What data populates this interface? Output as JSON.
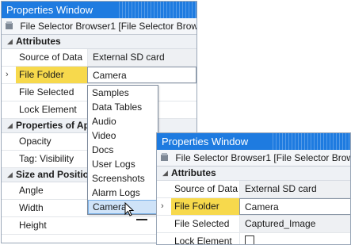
{
  "colors": {
    "titlebar": "#1e7be0",
    "selected_row": "#f7d94c",
    "highlight": "#cfe3f8"
  },
  "window1": {
    "title": "Properties Window",
    "object": "File Selector Browser1 [File Selector Browser]",
    "categories": {
      "attributes": "Attributes",
      "properties": "Properties of App",
      "size": "Size and Position"
    },
    "rows": {
      "source": {
        "label": "Source of Data",
        "value": "External SD card"
      },
      "folder": {
        "label": "File Folder",
        "value": "Camera"
      },
      "file_selected": {
        "label": "File Selected"
      },
      "lock": {
        "label": "Lock Element"
      },
      "opacity": {
        "label": "Opacity"
      },
      "tag": {
        "label": "Tag: Visibility"
      },
      "angle": {
        "label": "Angle"
      },
      "width": {
        "label": "Width"
      },
      "height": {
        "label": "Height"
      }
    },
    "dropdown_options": [
      "Samples",
      "Data Tables",
      "Audio",
      "Video",
      "Docs",
      "User Logs",
      "Screenshots",
      "Alarm Logs",
      "Camera"
    ],
    "dropdown_highlighted": "Camera"
  },
  "window2": {
    "title": "Properties Window",
    "object": "File Selector Browser1 [File Selector Browser]",
    "category": "Attributes",
    "rows": {
      "source": {
        "label": "Source of Data",
        "value": "External SD card"
      },
      "folder": {
        "label": "File Folder",
        "value": "Camera"
      },
      "file_selected": {
        "label": "File Selected",
        "value": "Captured_Image"
      },
      "lock": {
        "label": "Lock Element"
      }
    }
  }
}
